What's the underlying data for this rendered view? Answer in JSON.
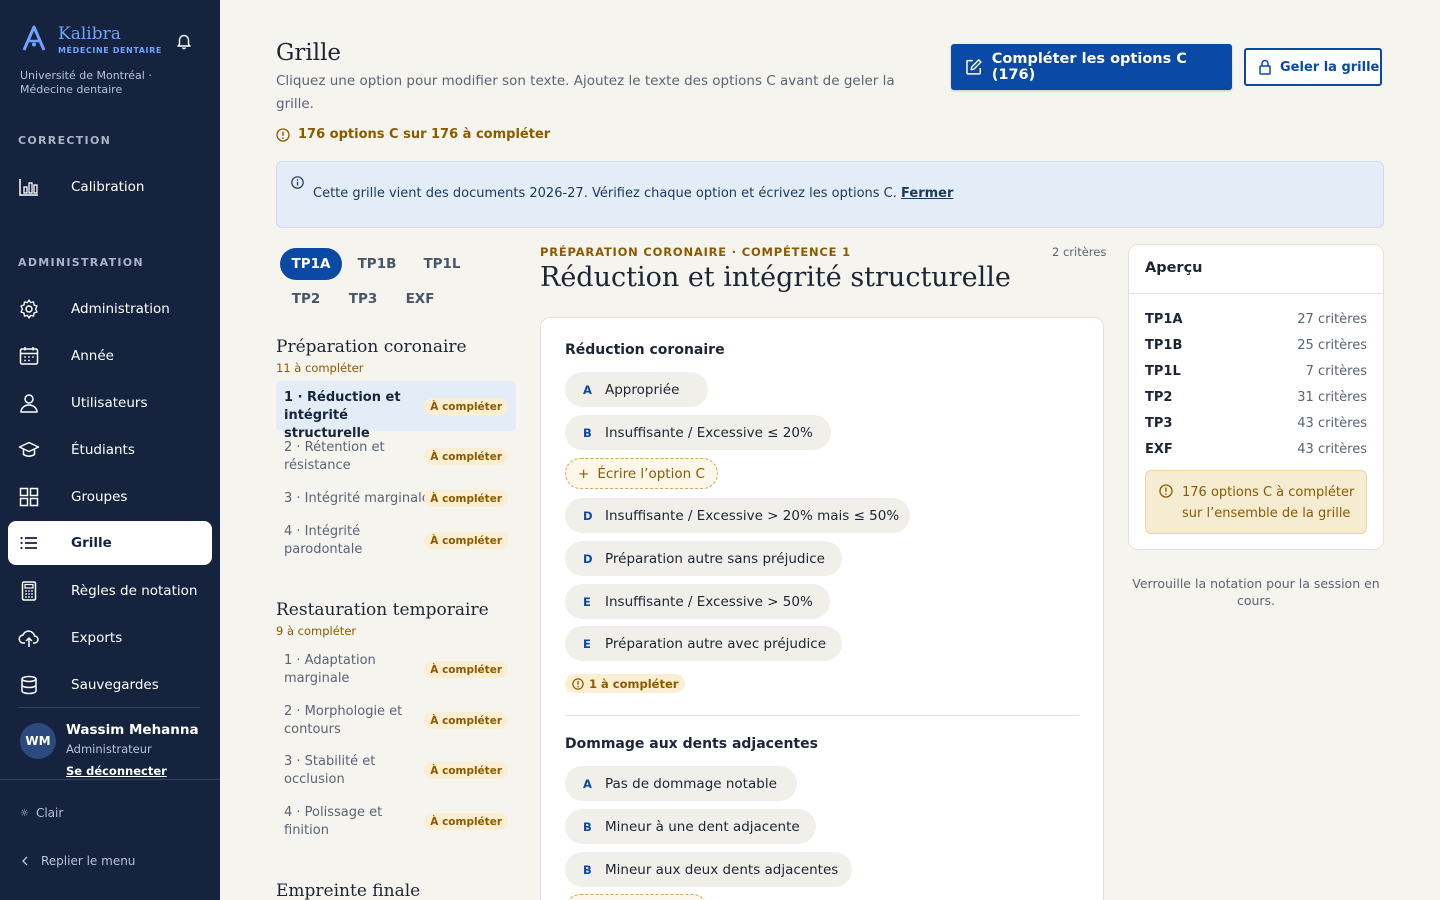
{
  "sidebar": {
    "brand": {
      "name": "Kalibra",
      "subtitle": "MÉDECINE DENTAIRE",
      "institution": "Université de Montréal · Médecine dentaire"
    },
    "sections": {
      "correction": "CORRECTION",
      "administration": "ADMINISTRATION"
    },
    "items": [
      {
        "label": "Calibration",
        "icon": "chart-icon"
      },
      {
        "label": "Administration",
        "icon": "gear-icon"
      },
      {
        "label": "Année",
        "icon": "calendar-icon"
      },
      {
        "label": "Utilisateurs",
        "icon": "user-icon"
      },
      {
        "label": "Étudiants",
        "icon": "graduation-icon"
      },
      {
        "label": "Groupes",
        "icon": "grid-icon"
      },
      {
        "label": "Grille",
        "icon": "list-icon"
      },
      {
        "label": "Règles de notation",
        "icon": "calculator-icon"
      },
      {
        "label": "Exports",
        "icon": "cloud-upload-icon"
      },
      {
        "label": "Sauvegardes",
        "icon": "database-icon"
      }
    ],
    "user": {
      "initials": "WM",
      "name": "Wassim Mehanna",
      "role": "Administrateur",
      "logout": "Se déconnecter"
    },
    "theme": "Clair",
    "collapse": "Replier le menu"
  },
  "header": {
    "title": "Grille",
    "description": "Cliquez une option pour modifier son texte. Ajoutez le texte des options C avant de geler la grille.",
    "warning": "176 options C sur 176 à compléter",
    "primary_button": "Compléter les options C (176)",
    "secondary_button": "Geler la grille"
  },
  "banner": {
    "text": "Cette grille vient des documents 2026-27. Vérifiez chaque option et écrivez les options C.",
    "close": "Fermer"
  },
  "tabs": [
    "TP1A",
    "TP1B",
    "TP1L",
    "TP2",
    "TP3",
    "EXF"
  ],
  "groups": [
    {
      "title": "Préparation coronaire",
      "subtitle": "11 à compléter",
      "criteria": [
        {
          "label": "1 · Réduction et intégrité structurelle",
          "badge": "À compléter"
        },
        {
          "label": "2 · Rétention et résistance",
          "badge": "À compléter"
        },
        {
          "label": "3 · Intégrité marginale",
          "badge": "À compléter"
        },
        {
          "label": "4 · Intégrité parodontale",
          "badge": "À compléter"
        }
      ]
    },
    {
      "title": "Restauration temporaire",
      "subtitle": "9 à compléter",
      "criteria": [
        {
          "label": "1 · Adaptation marginale",
          "badge": "À compléter"
        },
        {
          "label": "2 · Morphologie et contours",
          "badge": "À compléter"
        },
        {
          "label": "3 · Stabilité et occlusion",
          "badge": "À compléter"
        },
        {
          "label": "4 · Polissage et finition",
          "badge": "À compléter"
        }
      ]
    },
    {
      "title": "Empreinte finale"
    }
  ],
  "main": {
    "kicker": "PRÉPARATION CORONAIRE · COMPÉTENCE 1",
    "count": "2 critères",
    "title": "Réduction et intégrité structurelle",
    "sub1": {
      "title": "Réduction coronaire",
      "options": [
        {
          "key": "A",
          "text": "Appropriée"
        },
        {
          "key": "B",
          "text": "Insuffisante / Excessive ≤ 20%"
        },
        {
          "key": "D",
          "text": "Insuffisante / Excessive > 20% mais ≤ 50%"
        },
        {
          "key": "D",
          "text": "Préparation autre sans préjudice"
        },
        {
          "key": "E",
          "text": "Insuffisante / Excessive > 50%"
        },
        {
          "key": "E",
          "text": "Préparation autre avec préjudice"
        }
      ],
      "write_c": "Écrire l’option C",
      "pending": "1 à compléter"
    },
    "sub2": {
      "title": "Dommage aux dents adjacentes",
      "options": [
        {
          "key": "A",
          "text": "Pas de dommage notable"
        },
        {
          "key": "B",
          "text": "Mineur à une dent adjacente"
        },
        {
          "key": "B",
          "text": "Mineur aux deux dents adjacentes"
        }
      ]
    }
  },
  "preview": {
    "title": "Aperçu",
    "rows": [
      {
        "name": "TP1A",
        "count": "27 critères"
      },
      {
        "name": "TP1B",
        "count": "25 critères"
      },
      {
        "name": "TP1L",
        "count": "7 critères"
      },
      {
        "name": "TP2",
        "count": "31 critères"
      },
      {
        "name": "TP3",
        "count": "43 critères"
      },
      {
        "name": "EXF",
        "count": "43 critères"
      }
    ],
    "warning": "176 options C à compléter sur l’ensemble de la grille",
    "note": "Verrouille la notation pour la session en cours."
  },
  "colors": {
    "sidebar": "#15233f",
    "accent": "#0a4aa6",
    "warning": "#8a5a00",
    "background": "#f6f4ee"
  }
}
